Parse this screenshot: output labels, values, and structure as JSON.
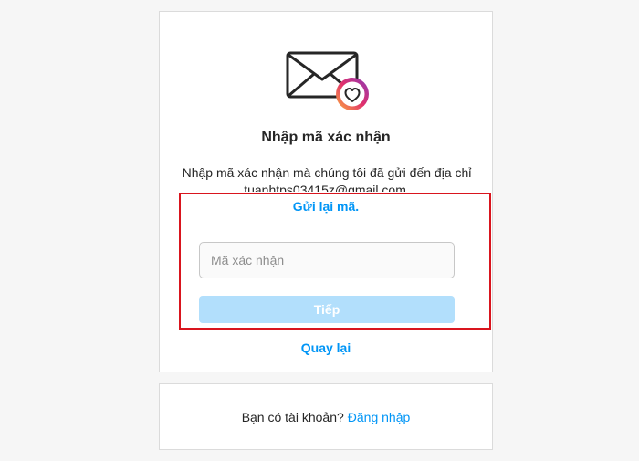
{
  "confirm_card": {
    "icon": "envelope-heart-icon",
    "title": "Nhập mã xác nhận",
    "description": "Nhập mã xác nhận mà chúng tôi đã gửi đến địa chỉ tuanhtps03415z@gmail.com.",
    "resend_label": "Gửi lại mã.",
    "code_placeholder": "Mã xác nhận",
    "code_value": "",
    "next_label": "Tiếp",
    "back_label": "Quay lại"
  },
  "login_card": {
    "prompt": "Bạn có tài khoản?",
    "login_label": "Đăng nhập"
  },
  "colors": {
    "link": "#0095f6",
    "button_disabled": "#b2dffc",
    "highlight": "#d9151e"
  }
}
